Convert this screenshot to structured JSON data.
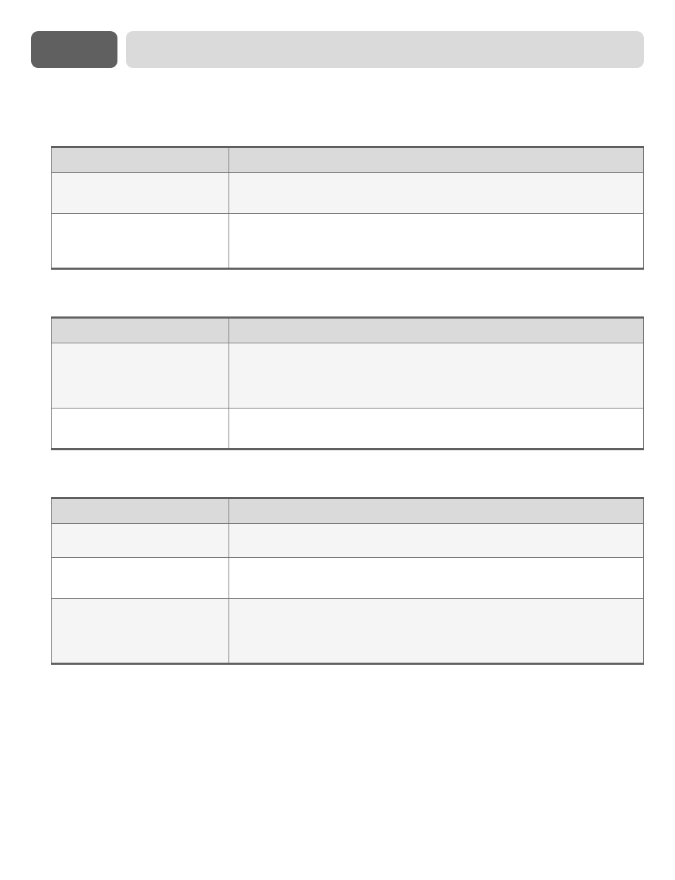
{
  "header": {
    "badge_label": "",
    "title": ""
  },
  "tables": [
    {
      "name": "table-a",
      "columns": [
        "",
        ""
      ],
      "rows": [
        {
          "left": "",
          "right": "",
          "shade": true,
          "size": "med"
        },
        {
          "left": "",
          "right": "",
          "shade": false,
          "size": "large"
        }
      ]
    },
    {
      "name": "table-b",
      "columns": [
        "",
        ""
      ],
      "rows": [
        {
          "left": "",
          "right": "",
          "shade": true,
          "size": "xlarge"
        },
        {
          "left": "",
          "right": "",
          "shade": false,
          "size": "med"
        }
      ]
    },
    {
      "name": "table-c",
      "columns": [
        "",
        ""
      ],
      "rows": [
        {
          "left": "",
          "right": "",
          "shade": true,
          "size": "small"
        },
        {
          "left": "",
          "right": "",
          "shade": false,
          "size": "med"
        },
        {
          "left": "",
          "right": "",
          "shade": true,
          "size": "xlarge"
        }
      ]
    }
  ]
}
